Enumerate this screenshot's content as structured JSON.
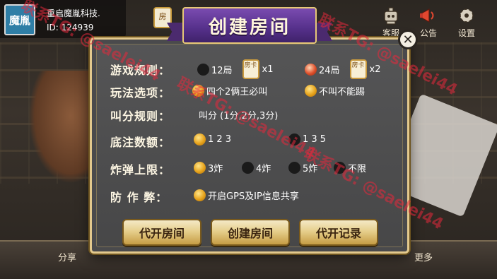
{
  "user": {
    "avatar_text": "魔胤",
    "name": "重启魔胤科技.",
    "id_text": "ID: 124939"
  },
  "top_card_icon": "房",
  "top_right": [
    {
      "key": "service",
      "label": "客服",
      "icon": "robot-icon"
    },
    {
      "key": "notice",
      "label": "公告",
      "icon": "megaphone-icon"
    },
    {
      "key": "settings",
      "label": "设置",
      "icon": "gear-icon"
    }
  ],
  "dialog": {
    "title": "创建房间",
    "close_glyph": "✕",
    "rows": {
      "rules_label": "游戏规则：",
      "play_label": "玩法选项：",
      "bid_label": "叫分规则：",
      "base_label": "底注数额：",
      "bomb_label": "炸弹上限：",
      "anticheat_label": "防 作 弊："
    },
    "rules": [
      {
        "label": "12局",
        "card": "房卡",
        "mult": "x1",
        "selected": false
      },
      {
        "label": "24局",
        "card": "房卡",
        "mult": "x2",
        "selected": true
      }
    ],
    "play": [
      {
        "label": "四个2俩王必叫",
        "selected": true
      },
      {
        "label": "不叫不能踢",
        "selected": true
      }
    ],
    "bid_text": "叫分 (1分,2分,3分)",
    "base": [
      {
        "label": "1 2 3",
        "selected": true
      },
      {
        "label": "1 3 5",
        "selected": false
      }
    ],
    "bomb": [
      {
        "label": "3炸",
        "selected": true
      },
      {
        "label": "4炸",
        "selected": false
      },
      {
        "label": "5炸",
        "selected": false
      },
      {
        "label": "不限",
        "selected": false
      }
    ],
    "anticheat": {
      "label": "开启GPS及IP信息共享",
      "selected": true
    },
    "buttons": {
      "proxy_open": "代开房间",
      "create": "创建房间",
      "proxy_record": "代开记录"
    }
  },
  "bottom": {
    "share": "分享",
    "more": "更多"
  },
  "watermarks": [
    "联系TG: @saelei44",
    "联系TG: @saelei44",
    "联系TG: @saelei44",
    "联系TG: @saelei44"
  ]
}
